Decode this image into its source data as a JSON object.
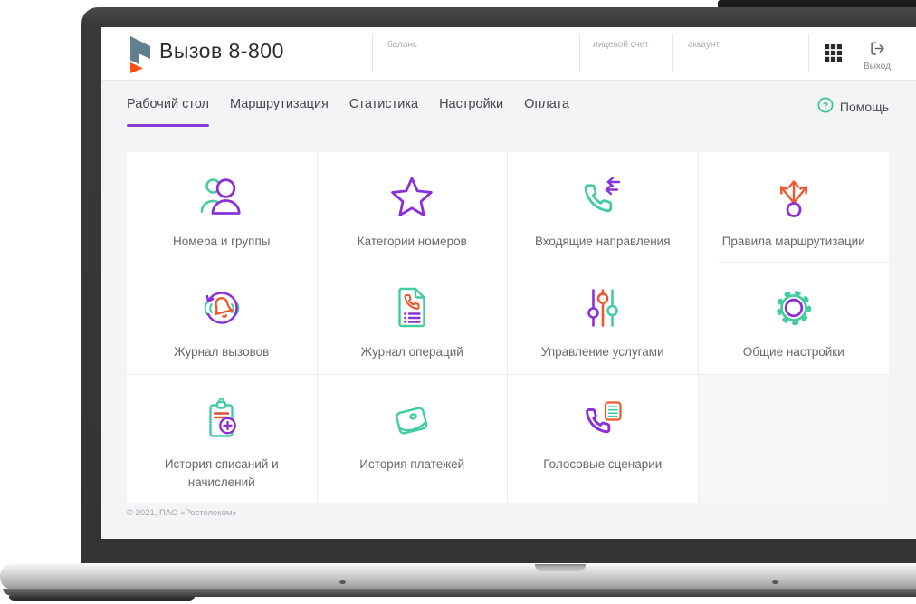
{
  "app": {
    "title": "Вызов 8-800"
  },
  "header": {
    "balance_label": "баланс",
    "account_number_label": "лицевой счет",
    "account_label": "аккаунт",
    "exit_label": "Выход"
  },
  "nav": {
    "tabs": [
      {
        "label": "Рабочий стол",
        "active": true
      },
      {
        "label": "Маршрутизация",
        "active": false
      },
      {
        "label": "Статистика",
        "active": false
      },
      {
        "label": "Настройки",
        "active": false
      },
      {
        "label": "Оплата",
        "active": false
      }
    ],
    "help_label": "Помощь"
  },
  "tiles": [
    {
      "label": "Номера и группы",
      "icon": "users-icon"
    },
    {
      "label": "Категории номеров",
      "icon": "star-icon"
    },
    {
      "label": "Входящие направления",
      "icon": "incoming-phone-icon"
    },
    {
      "label": "Правила маршрутизации",
      "icon": "routing-arrows-icon"
    },
    {
      "label": "Журнал вызовов",
      "icon": "call-history-bell-icon"
    },
    {
      "label": "Журнал операций",
      "icon": "operations-document-icon"
    },
    {
      "label": "Управление услугами",
      "icon": "sliders-icon"
    },
    {
      "label": "Общие настройки",
      "icon": "gear-icon"
    },
    {
      "label": "История списаний и начислений",
      "icon": "clipboard-plus-icon"
    },
    {
      "label": "История платежей",
      "icon": "wallet-icon"
    },
    {
      "label": "Голосовые сценарии",
      "icon": "voice-script-phone-icon"
    }
  ],
  "footer": {
    "copyright": "© 2021, ПАО «Ростелеком»"
  },
  "colors": {
    "purple": "#8b2fd9",
    "green": "#43cba2",
    "orange": "#f1572c"
  }
}
